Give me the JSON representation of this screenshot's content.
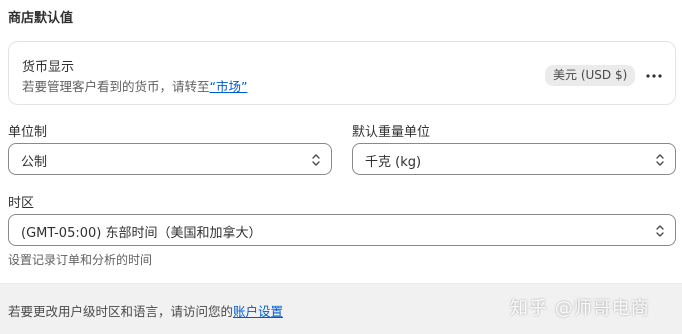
{
  "section": {
    "title": "商店默认值"
  },
  "currency_card": {
    "title": "货币显示",
    "description_prefix": "若要管理客户看到的货币，请转至",
    "market_link": "“市场”",
    "badge": "美元 (USD $)",
    "more_icon": "ellipsis-horizontal-icon"
  },
  "unit_system": {
    "label": "单位制",
    "value": "公制"
  },
  "weight_unit": {
    "label": "默认重量单位",
    "value": "千克 (kg)"
  },
  "timezone": {
    "label": "时区",
    "value": "(GMT-05:00) 东部时间（美国和加拿大）",
    "help": "设置记录订单和分析的时间"
  },
  "footer": {
    "text_prefix": "若要更改用户级时区和语言，请访问您的",
    "link": "账户设置"
  },
  "watermark": "知乎 @师哥电商",
  "colors": {
    "link": "#005bd3",
    "border": "#8a8a8a",
    "footer_bg": "#f1f1f1"
  }
}
